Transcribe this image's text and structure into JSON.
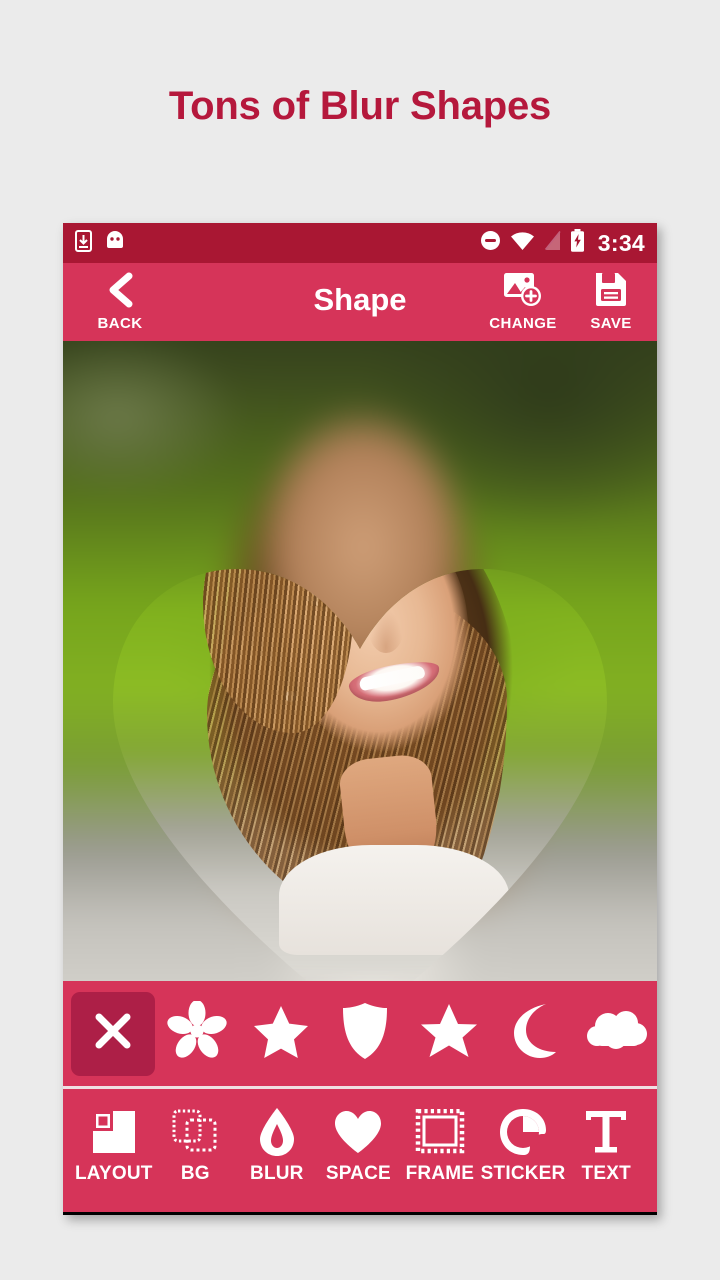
{
  "headline": "Tons of Blur Shapes",
  "colors": {
    "page_bg": "#ebebeb",
    "headline": "#b5183c",
    "statusbar": "#a91733",
    "accent_pink": "#d63459",
    "selected_shape": "#ad1f47"
  },
  "statusbar": {
    "left_icons": [
      "download-icon",
      "android-robot-icon"
    ],
    "right_icons": [
      "do-not-disturb-icon",
      "wifi-icon",
      "cellular-signal-icon",
      "battery-charging-icon"
    ],
    "time": "3:34"
  },
  "appbar": {
    "title": "Shape",
    "back_label": "BACK",
    "back_icon": "chevron-left-icon",
    "change_label": "CHANGE",
    "change_icon": "image-add-icon",
    "save_label": "SAVE",
    "save_icon": "floppy-disk-icon"
  },
  "canvas": {
    "description": "Blurred photo of a smiling girl in a park with a sharp heart-shaped cutout revealing the in-focus face",
    "active_shape": "heart"
  },
  "shape_strip": {
    "selected_index": 0,
    "items": [
      {
        "name": "none",
        "icon": "close-x-icon",
        "selected": true
      },
      {
        "name": "flower",
        "icon": "flower-icon",
        "selected": false
      },
      {
        "name": "star",
        "icon": "star-icon",
        "selected": false
      },
      {
        "name": "shield",
        "icon": "shield-icon",
        "selected": false
      },
      {
        "name": "star-alt",
        "icon": "star-alt-icon",
        "selected": false
      },
      {
        "name": "moon",
        "icon": "crescent-moon-icon",
        "selected": false
      },
      {
        "name": "cloud",
        "icon": "cloud-icon",
        "selected": false
      }
    ]
  },
  "bottom_toolbar": {
    "items": [
      {
        "label": "LAYOUT",
        "icon": "layout-icon"
      },
      {
        "label": "BG",
        "icon": "background-layers-icon"
      },
      {
        "label": "BLUR",
        "icon": "water-drop-icon"
      },
      {
        "label": "SPACE",
        "icon": "heart-icon"
      },
      {
        "label": "FRAME",
        "icon": "stamp-frame-icon"
      },
      {
        "label": "STICKER",
        "icon": "sticker-peel-icon"
      },
      {
        "label": "TEXT",
        "icon": "text-t-icon"
      }
    ]
  }
}
